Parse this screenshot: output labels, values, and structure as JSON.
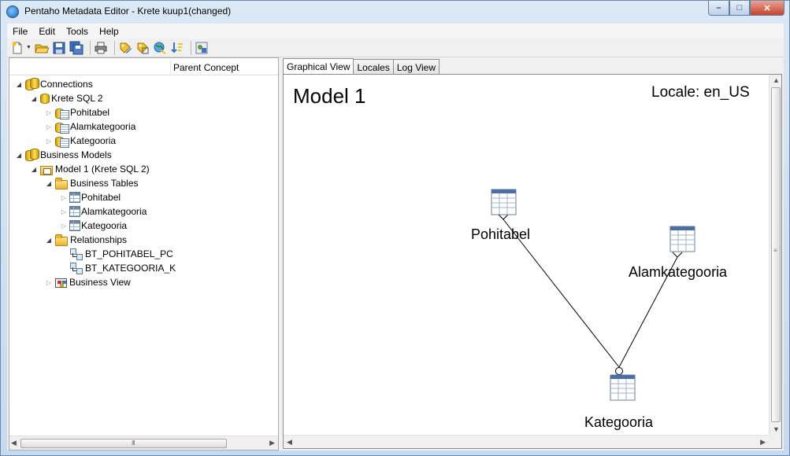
{
  "window": {
    "title": "Pentaho Metadata Editor - Krete kuup1(changed)",
    "controls": {
      "minimize": "–",
      "maximize": "□",
      "close": "✕"
    }
  },
  "menu": [
    "File",
    "Edit",
    "Tools",
    "Help"
  ],
  "toolbar": {
    "icons": [
      "new-file-icon",
      "open-folder-icon",
      "save-icon",
      "save-all-icon",
      "print-icon",
      "edit-concept-icon",
      "concept-editor-icon",
      "locale-icon",
      "sort-icon",
      "security-icon"
    ]
  },
  "tree": {
    "column_header": "Parent Concept",
    "items": [
      {
        "label": "Connections",
        "icon": "databases-icon",
        "twisty": "expanded"
      },
      {
        "label": "Krete SQL 2",
        "icon": "database-icon",
        "twisty": "expanded"
      },
      {
        "label": "Pohitabel",
        "icon": "database-table-icon",
        "twisty": "collapsed"
      },
      {
        "label": "Alamkategooria",
        "icon": "database-table-icon",
        "twisty": "collapsed"
      },
      {
        "label": "Kategooria",
        "icon": "database-table-icon",
        "twisty": "collapsed"
      },
      {
        "label": "Business Models",
        "icon": "databases-icon",
        "twisty": "expanded"
      },
      {
        "label": "Model 1 (Krete SQL 2)",
        "icon": "business-model-icon",
        "twisty": "expanded"
      },
      {
        "label": "Business Tables",
        "icon": "folder-icon",
        "twisty": "expanded"
      },
      {
        "label": "Pohitabel",
        "icon": "table-icon",
        "twisty": "collapsed"
      },
      {
        "label": "Alamkategooria",
        "icon": "table-icon",
        "twisty": "collapsed"
      },
      {
        "label": "Kategooria",
        "icon": "table-icon",
        "twisty": "collapsed"
      },
      {
        "label": "Relationships",
        "icon": "folder-icon",
        "twisty": "expanded"
      },
      {
        "label": "BT_POHITABEL_PC",
        "icon": "relationship-icon",
        "twisty": "none"
      },
      {
        "label": "BT_KATEGOORIA_K",
        "icon": "relationship-icon",
        "twisty": "none"
      },
      {
        "label": "Business View",
        "icon": "business-view-icon",
        "twisty": "collapsed"
      }
    ]
  },
  "tabs": [
    "Graphical View",
    "Locales",
    "Log View"
  ],
  "active_tab": "Graphical View",
  "canvas": {
    "model_title": "Model 1",
    "locale": "Locale: en_US",
    "tables": [
      "Pohitabel",
      "Alamkategooria",
      "Kategooria"
    ],
    "relationships": [
      {
        "from": "Pohitabel",
        "to": "Kategooria"
      },
      {
        "from": "Alamkategooria",
        "to": "Kategooria"
      }
    ]
  },
  "scrollbar": {
    "grip": "III"
  }
}
